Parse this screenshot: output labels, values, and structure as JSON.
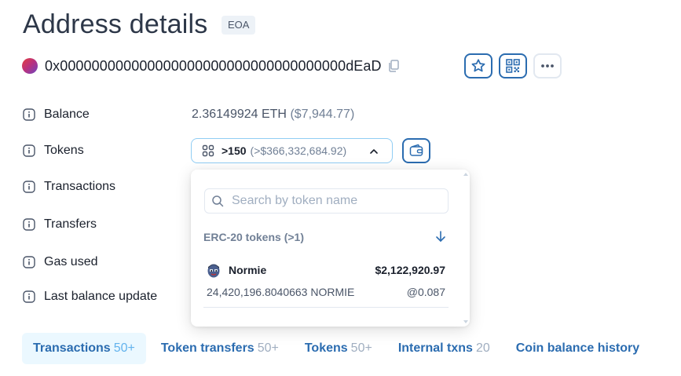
{
  "page": {
    "title": "Address details",
    "badge": "EOA"
  },
  "address": {
    "hash": "0x000000000000000000000000000000000000dEaD",
    "avatar_icon": "identicon-avatar",
    "copy_icon": "copy-icon"
  },
  "actions": {
    "favorite_icon": "star-icon",
    "qr_icon": "qr-code-icon",
    "more_icon": "more-horizontal-icon"
  },
  "details": {
    "balance_label": "Balance",
    "balance_value": "2.36149924 ETH",
    "balance_usd": "($7,944.77)",
    "tokens_label": "Tokens",
    "tokens_count": ">150",
    "tokens_usd": "(>$366,332,684.92)",
    "transactions_label": "Transactions",
    "transfers_label": "Transfers",
    "gas_used_label": "Gas used",
    "last_balance_update_label": "Last balance update"
  },
  "token_dropdown": {
    "search_placeholder": "Search by token name",
    "search_value": "",
    "group_header": "ERC-20 tokens (>1)",
    "items": [
      {
        "name": "Normie",
        "value_usd": "$2,122,920.97",
        "quantity": "24,420,196.8040663 NORMIE",
        "rate": "@0.087"
      }
    ]
  },
  "tabs": [
    {
      "label": "Transactions",
      "count": "50+",
      "active": true
    },
    {
      "label": "Token transfers",
      "count": "50+",
      "active": false
    },
    {
      "label": "Tokens",
      "count": "50+",
      "active": false
    },
    {
      "label": "Internal txns",
      "count": "20",
      "active": false
    },
    {
      "label": "Coin balance history",
      "count": "",
      "active": false
    }
  ],
  "colors": {
    "accent": "#2b6cb0",
    "active_tab_bg": "#ebf8ff",
    "muted_text": "#718096"
  }
}
